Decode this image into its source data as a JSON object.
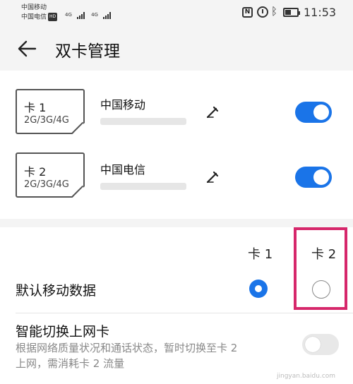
{
  "status_bar": {
    "carrier1": "中国移动",
    "carrier2": "中国电信",
    "hd_badge": "HD",
    "net1": "4G",
    "net2": "4G",
    "time": "11:53"
  },
  "header": {
    "title": "双卡管理"
  },
  "sims": [
    {
      "slot": "卡 1",
      "types": "2G/3G/4G",
      "operator": "中国移动",
      "enabled": true
    },
    {
      "slot": "卡 2",
      "types": "2G/3G/4G",
      "operator": "中国电信",
      "enabled": true
    }
  ],
  "mobile_data": {
    "col1": "卡 1",
    "col2": "卡 2",
    "label": "默认移动数据",
    "selected": "卡 1"
  },
  "smart_switch": {
    "title": "智能切换上网卡",
    "desc_line1": "根据网络质量状况和通话状态，暂时切换至卡 2",
    "desc_line2": "上网，需消耗卡 2 流量",
    "enabled": false
  },
  "watermark": "jingyan.baidu.com",
  "colors": {
    "accent": "#1a74e8",
    "highlight": "#d6276b"
  }
}
